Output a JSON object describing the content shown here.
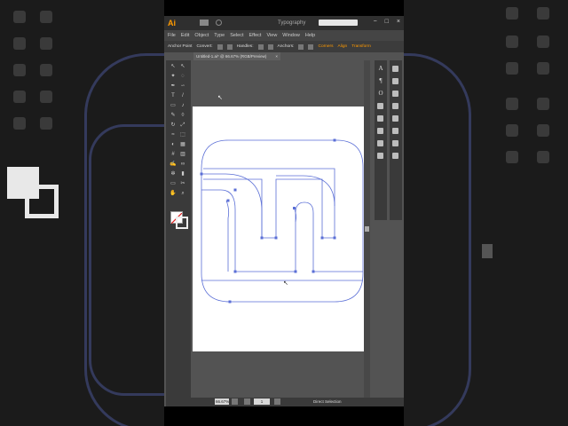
{
  "app": {
    "logo": "Ai",
    "workspace": "Typography",
    "search_placeholder": "",
    "window_buttons": [
      "−",
      "□",
      "×"
    ]
  },
  "menubar": {
    "items": [
      "File",
      "Edit",
      "Object",
      "Type",
      "Select",
      "Effect",
      "View",
      "Window",
      "Help"
    ]
  },
  "controlbar": {
    "anchor_point": "Anchor Point",
    "convert": "Convert:",
    "handles": "Handles:",
    "anchors": "Anchors:",
    "corners": "Corners",
    "align": "Align",
    "transform": "Transform"
  },
  "document": {
    "tab_title": "Untitled-1.ai* @ 66.67% (RGB/Preview)",
    "close": "×"
  },
  "statusbar": {
    "zoom": "66.67%",
    "page": "1",
    "tool": "Direct Selection"
  },
  "colors": {
    "app_bg": "#535353",
    "path_stroke": "#5b6fd6",
    "accent": "#ff9a00"
  },
  "icons": {
    "left_tools": [
      "selection-icon",
      "direct-selection-icon",
      "magic-wand-icon",
      "lasso-icon",
      "pen-icon",
      "curvature-icon",
      "type-icon",
      "line-icon",
      "rectangle-icon",
      "paintbrush-icon",
      "pencil-icon",
      "eraser-icon",
      "rotate-icon",
      "scale-icon",
      "width-icon",
      "free-transform-icon",
      "shape-builder-icon",
      "perspective-icon",
      "mesh-icon",
      "gradient-icon",
      "eyedropper-icon",
      "blend-icon",
      "symbol-sprayer-icon",
      "column-graph-icon",
      "artboard-icon",
      "slice-icon",
      "hand-icon",
      "zoom-icon"
    ],
    "right_panels": [
      "character-icon",
      "paragraph-icon",
      "opentype-icon",
      "color-icon",
      "swatches-icon",
      "brushes-icon",
      "symbols-icon",
      "graphic-styles-icon",
      "layers-icon",
      "stroke-icon",
      "gradient-panel-icon",
      "transparency-icon",
      "appearance-icon",
      "align-icon",
      "pathfinder-icon",
      "transform-icon"
    ]
  }
}
